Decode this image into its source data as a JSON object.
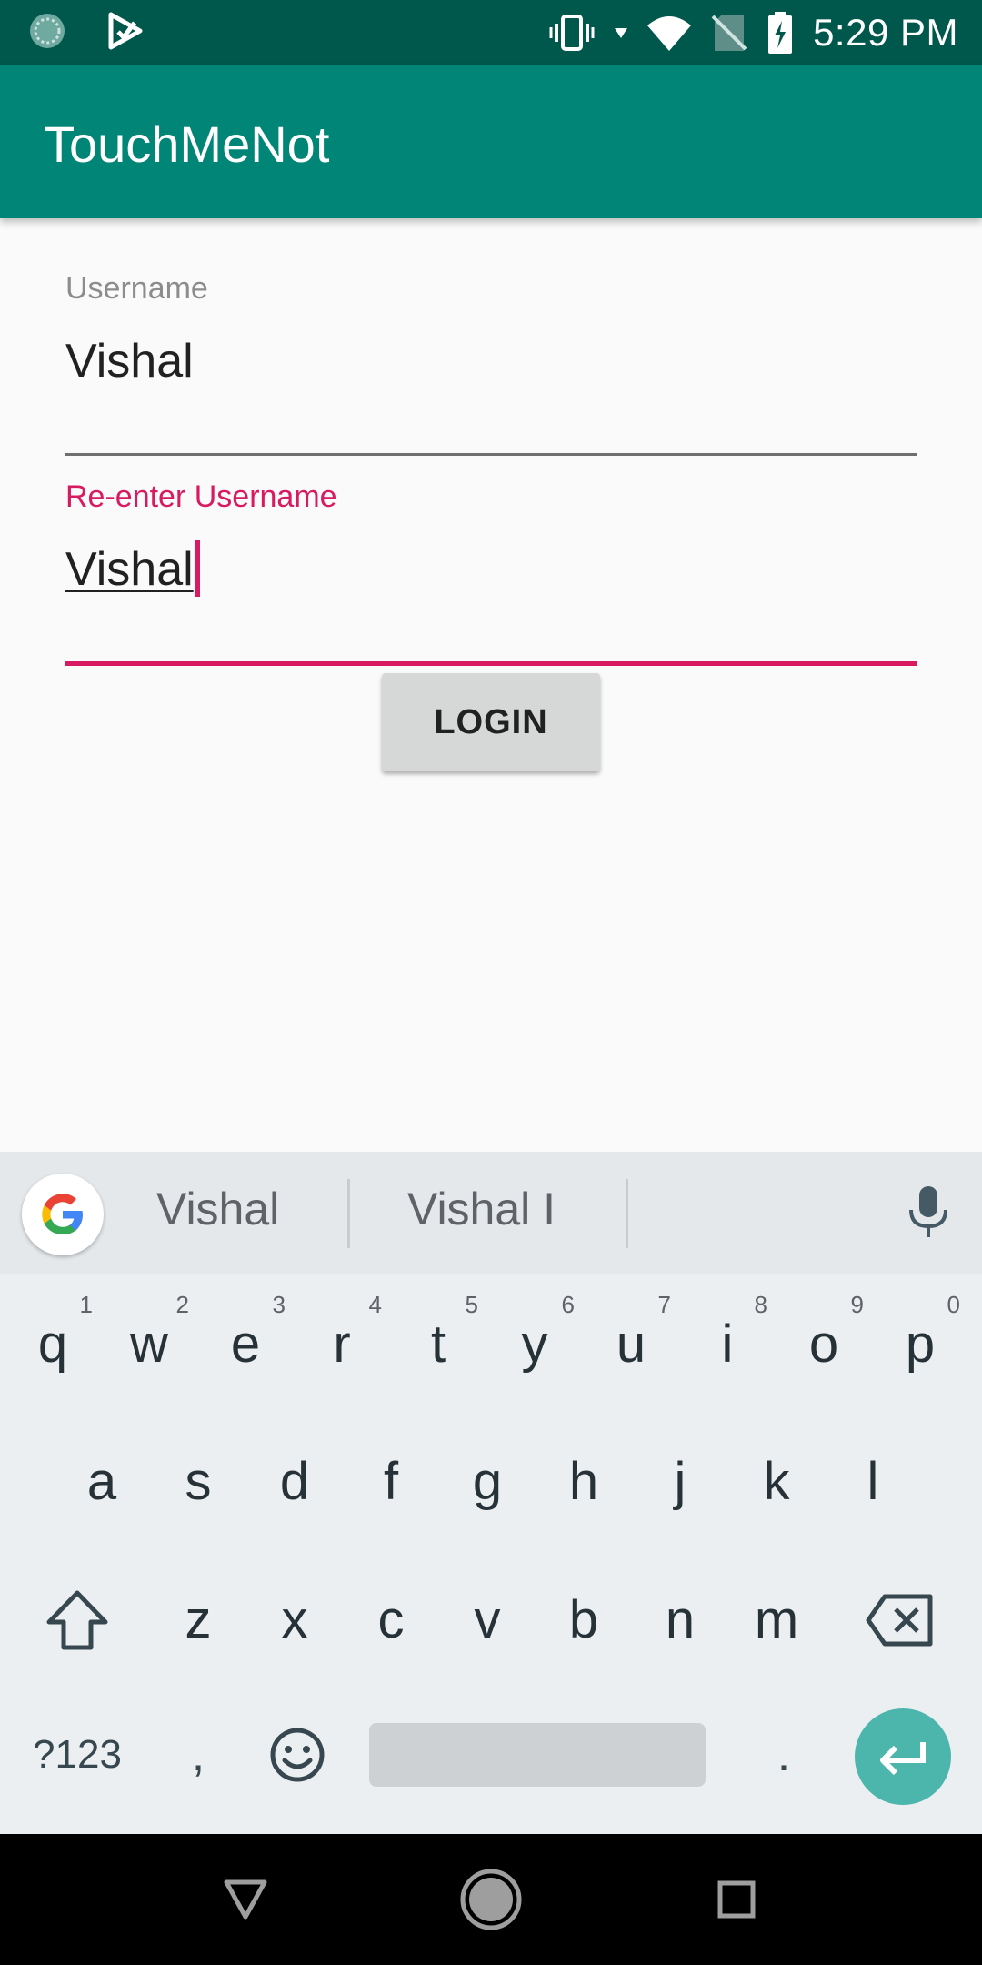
{
  "status_bar": {
    "time": "5:29 PM",
    "icons": [
      "sync-icon",
      "play-store-icon",
      "vibrate-icon",
      "data-arrow-icon",
      "wifi-icon",
      "no-sim-icon",
      "battery-charging-icon"
    ]
  },
  "app_bar": {
    "title": "TouchMeNot"
  },
  "form": {
    "username_label": "Username",
    "username_value": "Vishal",
    "reenter_label": "Re-enter Username",
    "reenter_value": "Vishal",
    "login_label": "LOGIN"
  },
  "keyboard": {
    "suggestions": [
      "Vishal",
      "Vishal I"
    ],
    "row1": [
      {
        "k": "q",
        "n": "1"
      },
      {
        "k": "w",
        "n": "2"
      },
      {
        "k": "e",
        "n": "3"
      },
      {
        "k": "r",
        "n": "4"
      },
      {
        "k": "t",
        "n": "5"
      },
      {
        "k": "y",
        "n": "6"
      },
      {
        "k": "u",
        "n": "7"
      },
      {
        "k": "i",
        "n": "8"
      },
      {
        "k": "o",
        "n": "9"
      },
      {
        "k": "p",
        "n": "0"
      }
    ],
    "row2": [
      "a",
      "s",
      "d",
      "f",
      "g",
      "h",
      "j",
      "k",
      "l"
    ],
    "row3": [
      "z",
      "x",
      "c",
      "v",
      "b",
      "n",
      "m"
    ],
    "symbols_label": "?123",
    "comma_label": ",",
    "period_label": "."
  },
  "colors": {
    "status_bar": "#00574b",
    "app_bar": "#008577",
    "accent": "#d81b60",
    "enter_key": "#4db6ac"
  }
}
